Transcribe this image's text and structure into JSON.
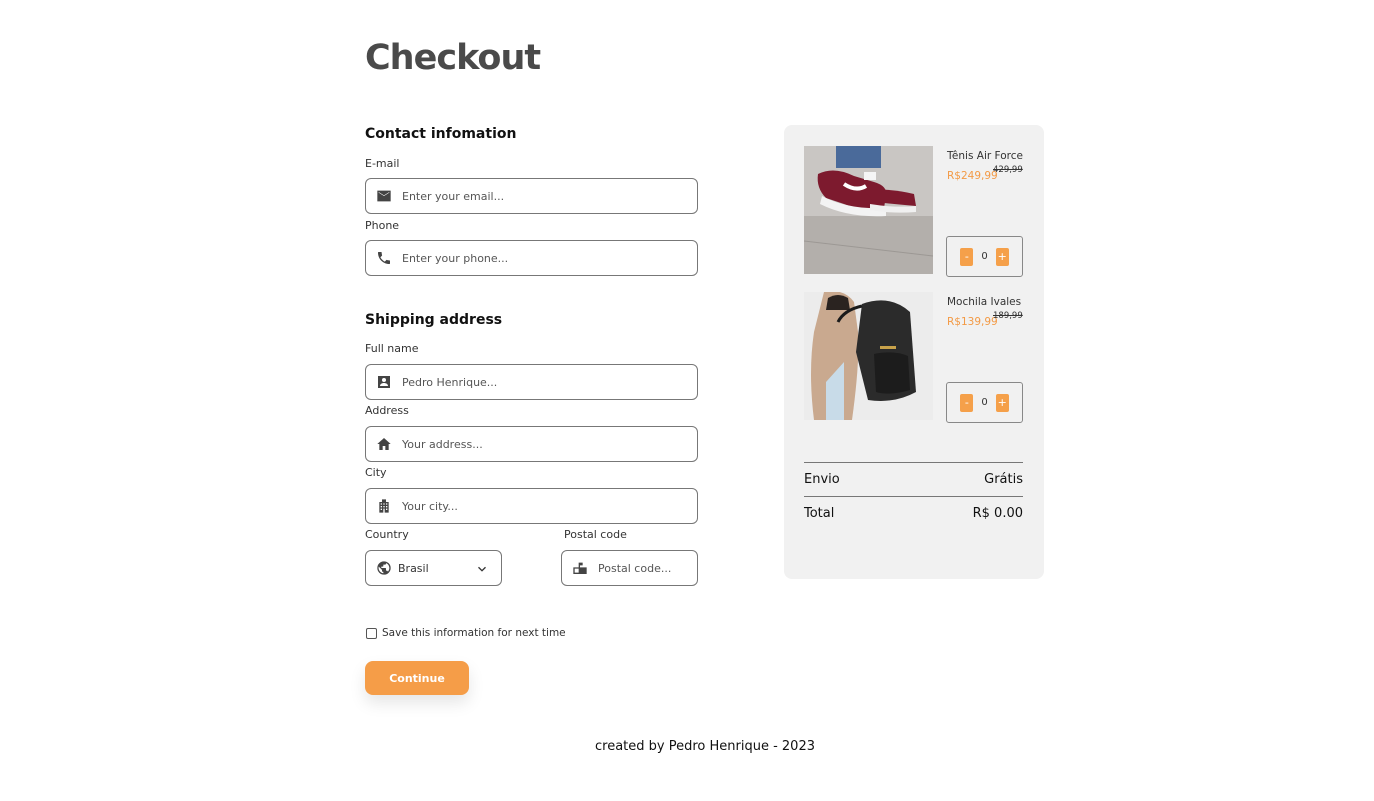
{
  "page": {
    "title": "Checkout"
  },
  "contact": {
    "title": "Contact infomation",
    "email": {
      "label": "E-mail",
      "placeholder": "Enter your email...",
      "icon": "mail-icon"
    },
    "phone": {
      "label": "Phone",
      "placeholder": "Enter your phone...",
      "icon": "phone-icon"
    }
  },
  "shipping": {
    "title": "Shipping address",
    "full_name": {
      "label": "Full name",
      "placeholder": "Pedro Henrique...",
      "icon": "contact-card-icon"
    },
    "address": {
      "label": "Address",
      "placeholder": "Your address...",
      "icon": "home-icon"
    },
    "city": {
      "label": "City",
      "placeholder": "Your city...",
      "icon": "building-icon"
    },
    "country": {
      "label": "Country",
      "value": "Brasil",
      "icon": "globe-icon"
    },
    "postal": {
      "label": "Postal code",
      "placeholder": "Postal code...",
      "icon": "mailbox-icon"
    }
  },
  "save_info": {
    "label": "Save this information for next time",
    "checked": false
  },
  "continue_label": "Continue",
  "cart": {
    "items": [
      {
        "name": "Tênis Air Force",
        "price": "R$249,99",
        "old_price": "429,99",
        "qty": "0",
        "minus": "-",
        "plus": "+"
      },
      {
        "name": "Mochila Ivales",
        "price": "R$139,99",
        "old_price": "189,99",
        "qty": "0",
        "minus": "-",
        "plus": "+"
      }
    ],
    "shipping_label": "Envio",
    "shipping_value": "Grátis",
    "total_label": "Total",
    "total_value": "R$ 0.00"
  },
  "footer": "created by Pedro Henrique - 2023",
  "colors": {
    "accent": "#f59d48",
    "cart_bg": "#f1f1f1",
    "title": "#4a4a4a"
  }
}
